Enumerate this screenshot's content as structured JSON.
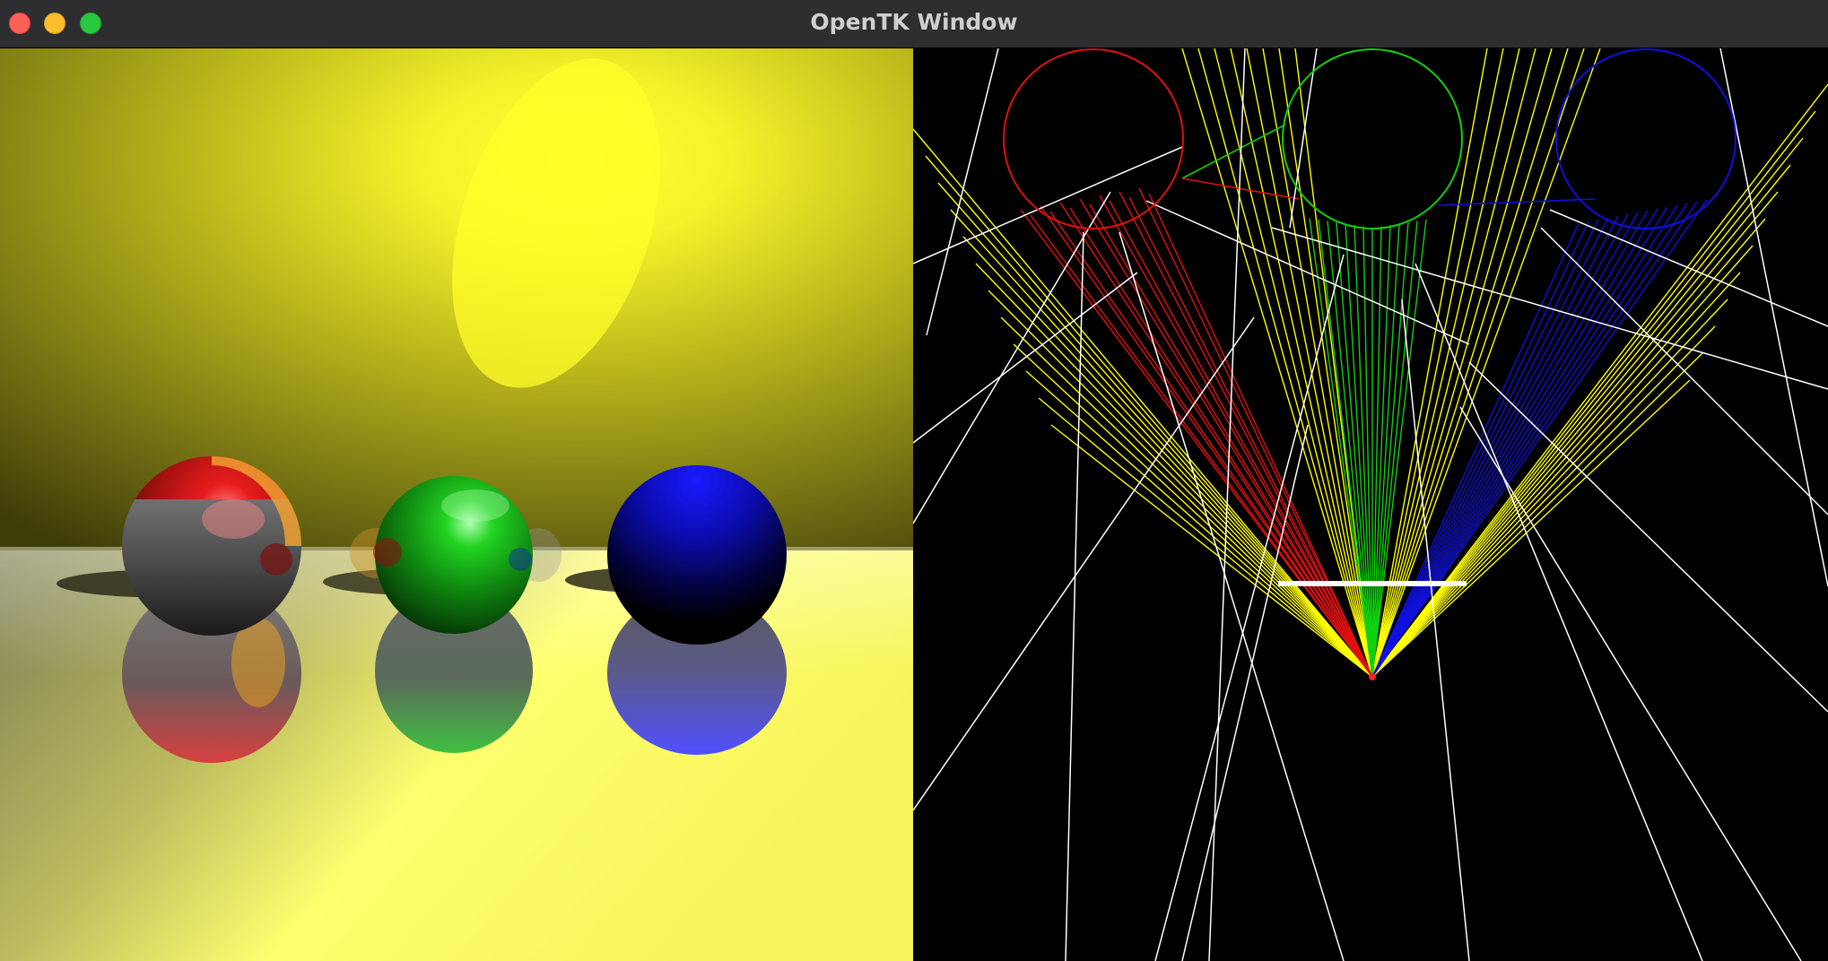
{
  "window": {
    "title": "OpenTK Window",
    "controls": {
      "close": "close-button",
      "minimize": "minimize-button",
      "zoom": "zoom-button"
    }
  },
  "scene": {
    "background_color": "#ffff40",
    "floor_color": "#ffff70",
    "spheres": [
      {
        "name": "red-sphere",
        "color": "#e01010"
      },
      {
        "name": "green-sphere",
        "color": "#10c010"
      },
      {
        "name": "blue-sphere",
        "color": "#1010ff"
      }
    ]
  },
  "debug_view": {
    "background_color": "#000000",
    "circle_colors": [
      "#e01010",
      "#10d010",
      "#1010e0"
    ],
    "ray_colors": [
      "#ffff00",
      "#ffffff"
    ]
  }
}
